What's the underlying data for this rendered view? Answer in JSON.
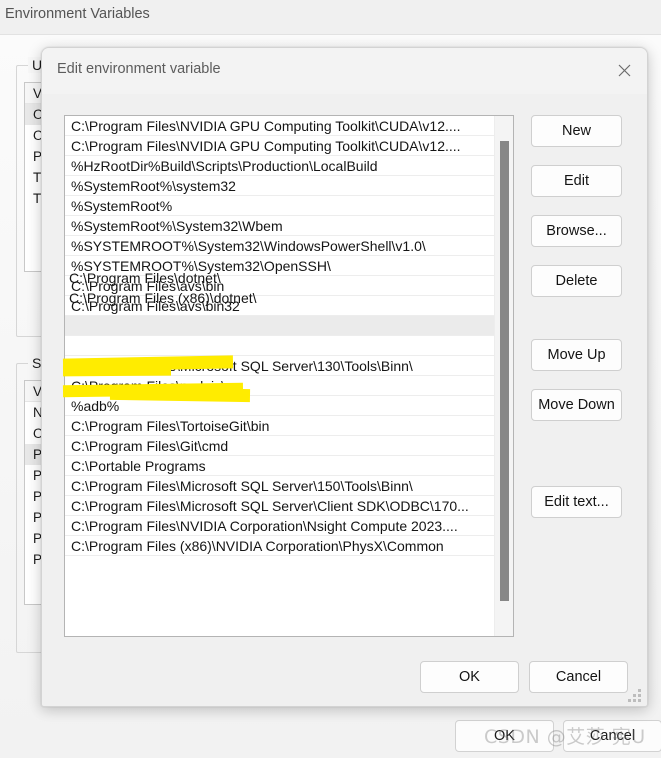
{
  "background_window": {
    "title": "Environment Variables",
    "user_section": {
      "label": "User",
      "column_header": "Va",
      "rows": [
        {
          "text": "On",
          "selected": true
        },
        {
          "text": "On",
          "selected": false
        },
        {
          "text": "Pat",
          "selected": false
        },
        {
          "text": "TE",
          "selected": false
        },
        {
          "text": "TM",
          "selected": false
        }
      ]
    },
    "system_section": {
      "label": "Syste",
      "column_header": "Va",
      "rows": [
        {
          "text": "NU",
          "selected": false
        },
        {
          "text": "OS",
          "selected": false
        },
        {
          "text": "Pa",
          "selected": true
        },
        {
          "text": "PA",
          "selected": false
        },
        {
          "text": "PR",
          "selected": false
        },
        {
          "text": "PR",
          "selected": false
        },
        {
          "text": "PR",
          "selected": false
        },
        {
          "text": "PR",
          "selected": false
        }
      ]
    },
    "buttons": {
      "ok": "OK",
      "cancel": "Cancel"
    }
  },
  "dialog": {
    "title": "Edit environment variable",
    "close_icon": "close-icon",
    "path_entries": [
      {
        "text": "C:\\Program Files\\NVIDIA GPU Computing Toolkit\\CUDA\\v12....",
        "selected": false,
        "highlighted": false
      },
      {
        "text": "C:\\Program Files\\NVIDIA GPU Computing Toolkit\\CUDA\\v12....",
        "selected": false,
        "highlighted": false
      },
      {
        "text": "%HzRootDir%Build\\Scripts\\Production\\LocalBuild",
        "selected": false,
        "highlighted": false
      },
      {
        "text": "%SystemRoot%\\system32",
        "selected": false,
        "highlighted": false
      },
      {
        "text": "%SystemRoot%",
        "selected": false,
        "highlighted": false
      },
      {
        "text": "%SystemRoot%\\System32\\Wbem",
        "selected": false,
        "highlighted": false
      },
      {
        "text": "%SYSTEMROOT%\\System32\\WindowsPowerShell\\v1.0\\",
        "selected": false,
        "highlighted": false
      },
      {
        "text": "%SYSTEMROOT%\\System32\\OpenSSH\\",
        "selected": false,
        "highlighted": false
      },
      {
        "text": "C:\\Program Files\\avs\\bin",
        "selected": false,
        "highlighted": false
      },
      {
        "text": "C:\\Program Files\\avs\\bin32",
        "selected": false,
        "highlighted": false
      },
      {
        "text": "C:\\Program Files\\dotnet\\",
        "selected": true,
        "highlighted": true
      },
      {
        "text": "C:\\Program Files (x86)\\dotnet\\",
        "selected": false,
        "highlighted": true
      },
      {
        "text": "C:\\Program Files\\Microsoft SQL Server\\130\\Tools\\Binn\\",
        "selected": false,
        "highlighted": false
      },
      {
        "text": "C:\\Program Files\\nodejs\\",
        "selected": false,
        "highlighted": false
      },
      {
        "text": "%adb%",
        "selected": false,
        "highlighted": false
      },
      {
        "text": "C:\\Program Files\\TortoiseGit\\bin",
        "selected": false,
        "highlighted": false
      },
      {
        "text": "C:\\Program Files\\Git\\cmd",
        "selected": false,
        "highlighted": false
      },
      {
        "text": "C:\\Portable Programs",
        "selected": false,
        "highlighted": false
      },
      {
        "text": "C:\\Program Files\\Microsoft SQL Server\\150\\Tools\\Binn\\",
        "selected": false,
        "highlighted": false
      },
      {
        "text": "C:\\Program Files\\Microsoft SQL Server\\Client SDK\\ODBC\\170...",
        "selected": false,
        "highlighted": false
      },
      {
        "text": "C:\\Program Files\\NVIDIA Corporation\\Nsight Compute 2023....",
        "selected": false,
        "highlighted": false
      },
      {
        "text": "C:\\Program Files (x86)\\NVIDIA Corporation\\PhysX\\Common",
        "selected": false,
        "highlighted": false
      }
    ],
    "side_buttons": [
      {
        "label": "New",
        "name": "new-button"
      },
      {
        "label": "Edit",
        "name": "edit-button"
      },
      {
        "label": "Browse...",
        "name": "browse-button"
      },
      {
        "label": "Delete",
        "name": "delete-button"
      },
      {
        "label": "Move Up",
        "name": "move-up-button"
      },
      {
        "label": "Move Down",
        "name": "move-down-button"
      },
      {
        "label": "Edit text...",
        "name": "edit-text-button"
      }
    ],
    "ok_label": "OK",
    "cancel_label": "Cancel",
    "scrollbar": {
      "name": "vertical-scrollbar"
    },
    "resize_grip": "resize-grip"
  },
  "watermark": "CSDN @艾莎 宪U",
  "colors": {
    "highlight_marker": "#ffec00",
    "selection": "#ebebeb",
    "dialog_chrome": "#f0f0f0",
    "scrollbar_thumb": "#878787"
  }
}
